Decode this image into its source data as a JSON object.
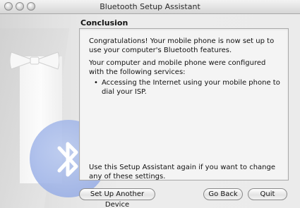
{
  "window": {
    "title": "Bluetooth Setup Assistant"
  },
  "page": {
    "heading": "Conclusion",
    "paragraph1": "Congratulations! Your mobile phone is now set up to use your computer's Bluetooth features.",
    "paragraph2": "Your computer and mobile phone were configured with the following services:",
    "bullet_char": "•",
    "services": [
      "Accessing the Internet using your mobile phone to dial your ISP."
    ],
    "footer_text": "Use this Setup Assistant again if you want to change any of these settings."
  },
  "buttons": {
    "setup_another": "Set Up Another Device",
    "go_back": "Go Back",
    "quit": "Quit"
  },
  "colors": {
    "bluetooth_blue": "#98aee6"
  }
}
